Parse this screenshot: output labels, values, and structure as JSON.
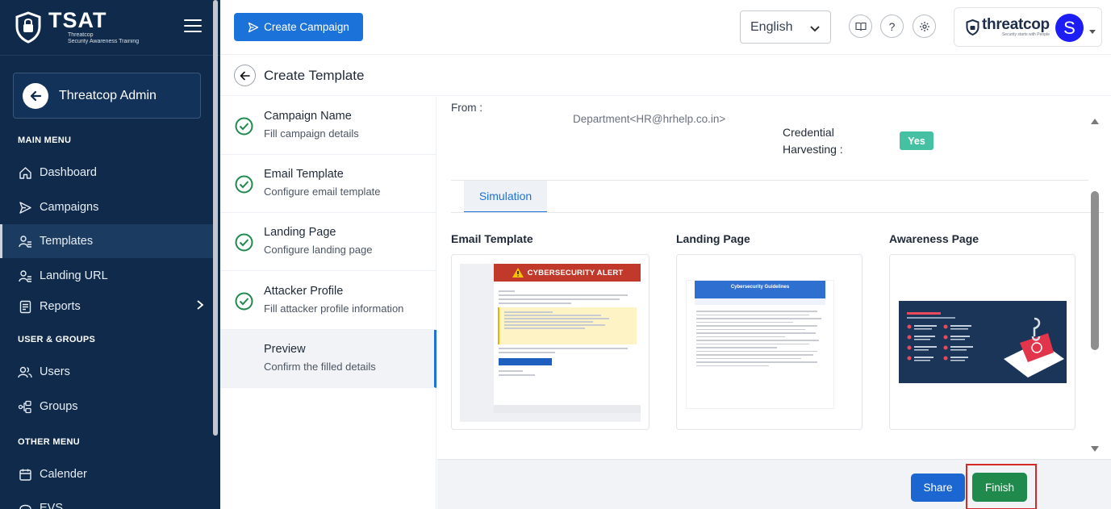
{
  "brand": {
    "name": "TSAT",
    "subtitle_line1": "Threatcop",
    "subtitle_line2": "Security Awareness Training"
  },
  "sidebar": {
    "admin_label": "Threatcop Admin",
    "main_menu_label": "MAIN MENU",
    "main_items": [
      {
        "label": "Dashboard",
        "icon": "home-icon"
      },
      {
        "label": "Campaigns",
        "icon": "send-icon"
      },
      {
        "label": "Templates",
        "icon": "templates-icon",
        "active": true
      },
      {
        "label": "Landing URL",
        "icon": "landing-url-icon"
      },
      {
        "label": "Reports",
        "icon": "reports-icon"
      }
    ],
    "users_groups_label": "USER & GROUPS",
    "ug_items": [
      {
        "label": "Users",
        "icon": "users-icon"
      },
      {
        "label": "Groups",
        "icon": "groups-icon"
      }
    ],
    "other_menu_label": "OTHER MENU",
    "other_items": [
      {
        "label": "Calender",
        "icon": "calendar-icon"
      },
      {
        "label": "EVS",
        "icon": "evs-icon"
      }
    ]
  },
  "header": {
    "create_campaign": "Create Campaign",
    "language": "English",
    "help_glyph": "?",
    "profile_logo": "threatcop",
    "profile_tagline": "Security starts with People",
    "avatar_letter": "S"
  },
  "page": {
    "title": "Create Template"
  },
  "steps": [
    {
      "title": "Campaign Name",
      "subtitle": "Fill campaign details",
      "done": true
    },
    {
      "title": "Email Template",
      "subtitle": "Configure email template",
      "done": true
    },
    {
      "title": "Landing Page",
      "subtitle": "Configure landing page",
      "done": true
    },
    {
      "title": "Attacker Profile",
      "subtitle": "Fill attacker profile information",
      "done": true
    },
    {
      "title": "Preview",
      "subtitle": "Confirm the filled details",
      "done": false,
      "active": true
    }
  ],
  "preview": {
    "from_label": "From :",
    "from_value": "Department<HR@hrhelp.co.in>",
    "credential_label_1": "Credential",
    "credential_label_2": "Harvesting :",
    "credential_value": "Yes",
    "tab_simulation": "Simulation",
    "cards": {
      "email_title": "Email Template",
      "landing_title": "Landing Page",
      "awareness_title": "Awareness Page",
      "email_alert": "CYBERSECURITY ALERT",
      "landing_heading": "Cybersecurity Guidelines"
    }
  },
  "footer": {
    "share": "Share",
    "finish": "Finish"
  },
  "colors": {
    "sidebar_bg": "#0f2a4a",
    "primary": "#1b73d9",
    "success": "#1f8a4c",
    "badge_yes": "#45c0a3",
    "highlight": "#d62828"
  }
}
